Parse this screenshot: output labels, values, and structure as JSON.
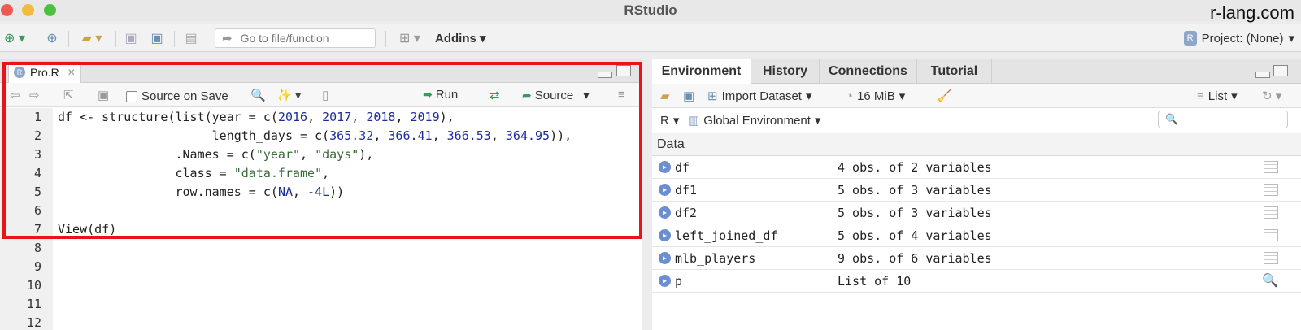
{
  "window": {
    "title": "RStudio",
    "watermark": "r-lang.com"
  },
  "toolbar": {
    "goto_placeholder": "Go to file/function",
    "addins_label": "Addins",
    "project_label": "Project: (None)"
  },
  "editor": {
    "tab_label": "Pro.R",
    "source_on_save_label": "Source on Save",
    "run_label": "Run",
    "source_label": "Source",
    "line_numbers": [
      "1",
      "2",
      "3",
      "4",
      "5",
      "6",
      "7",
      "8",
      "9",
      "10",
      "11",
      "12"
    ],
    "code_lines": [
      "df <- structure(list(year = c(2016, 2017, 2018, 2019),",
      "                     length_days = c(365.32, 366.41, 366.53, 364.95)),",
      "                .Names = c(\"year\", \"days\"),",
      "                class = \"data.frame\",",
      "                row.names = c(NA, -4L))",
      "",
      "View(df)"
    ]
  },
  "right_pane": {
    "tabs": [
      {
        "label": "Environment",
        "active": true
      },
      {
        "label": "History",
        "active": false
      },
      {
        "label": "Connections",
        "active": false
      },
      {
        "label": "Tutorial",
        "active": false
      }
    ],
    "import_dataset_label": "Import Dataset",
    "memory_label": "16 MiB",
    "list_view_label": "List",
    "language_label": "R",
    "scope_label": "Global Environment",
    "data_header": "Data",
    "rows": [
      {
        "name": "df",
        "value": "4 obs. of 2 variables",
        "icon": "grid-icon"
      },
      {
        "name": "df1",
        "value": "5 obs. of 3 variables",
        "icon": "grid-icon"
      },
      {
        "name": "df2",
        "value": "5 obs. of 3 variables",
        "icon": "grid-icon"
      },
      {
        "name": "left_joined_df",
        "value": "5 obs. of 4 variables",
        "icon": "grid-icon"
      },
      {
        "name": "mlb_players",
        "value": "9 obs. of 6 variables",
        "icon": "grid-icon"
      },
      {
        "name": "p",
        "value": "List of  10",
        "icon": "magnifier-icon"
      }
    ]
  },
  "colors": {
    "highlight": "#e8141a",
    "number": "#1e2d9a",
    "string": "#3c6b3c"
  }
}
